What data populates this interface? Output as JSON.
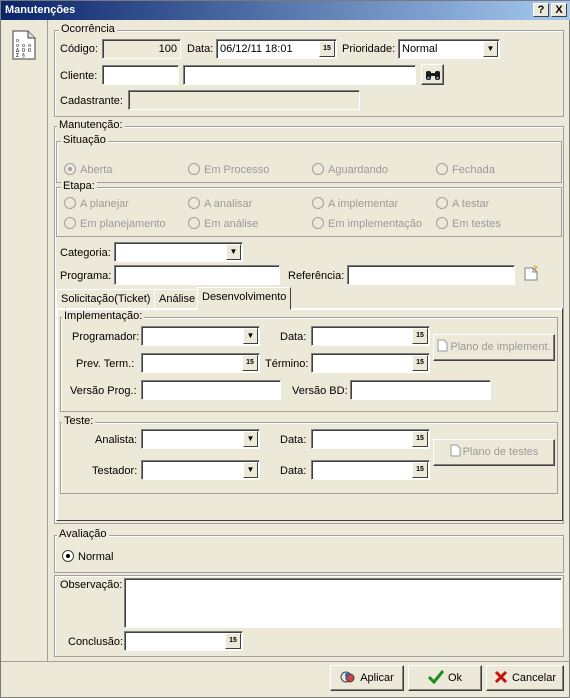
{
  "window": {
    "title": "Manutenções",
    "help": "?",
    "close": "X"
  },
  "ocorrencia": {
    "legend": "Ocorrência",
    "codigo_label": "Código:",
    "codigo_value": "100",
    "data_label": "Data:",
    "data_value": "06/12/11 18:01",
    "prioridade_label": "Prioridade:",
    "prioridade_value": "Normal",
    "cliente_label": "Cliente:",
    "cliente_code": "",
    "cliente_name": "",
    "cadastrante_label": "Cadastrante:",
    "cadastrante_value": ""
  },
  "manutencao": {
    "legend": "Manutenção:",
    "situacao": {
      "legend": "Situação",
      "options": [
        "Aberta",
        "Em Processo",
        "Aguardando",
        "Fechada"
      ],
      "selected": "Aberta"
    },
    "etapa": {
      "legend": "Etapa:",
      "options": [
        "A planejar",
        "A analisar",
        "A implementar",
        "A testar",
        "Em planejamento",
        "Em análise",
        "Em implementação",
        "Em testes"
      ]
    },
    "categoria_label": "Categoria:",
    "categoria_value": "",
    "programa_label": "Programa:",
    "programa_value": "",
    "referencia_label": "Referência:",
    "referencia_value": ""
  },
  "tabs": [
    "Solicitação(Ticket)",
    "Análise",
    "Desenvolvimento"
  ],
  "active_tab": "Desenvolvimento",
  "implementacao": {
    "legend": "Implementação:",
    "programador_label": "Programador:",
    "programador_value": "",
    "data_label": "Data:",
    "data_value": "",
    "prev_term_label": "Prev. Term.:",
    "prev_term_value": "",
    "termino_label": "Término:",
    "termino_value": "",
    "plano_button": "Plano de implement.",
    "versao_prog_label": "Versão Prog.:",
    "versao_prog_value": "",
    "versao_bd_label": "Versão BD:",
    "versao_bd_value": ""
  },
  "teste": {
    "legend": "Teste:",
    "analista_label": "Analista:",
    "analista_value": "",
    "data_label": "Data:",
    "data_value": "",
    "testador_label": "Testador:",
    "testador_value": "",
    "data2_label": "Data:",
    "data2_value": "",
    "plano_button": "Plano de testes"
  },
  "avaliacao": {
    "legend": "Avaliação",
    "option": "Normal"
  },
  "observacao_label": "Observação:",
  "observacao_value": "",
  "conclusao_label": "Conclusão:",
  "conclusao_value": "",
  "buttons": {
    "apply": "Aplicar",
    "ok": "Ok",
    "cancel": "Cancelar"
  },
  "calendar_icon_text": "15",
  "colors": {
    "titlebar_start": "#0a246a",
    "titlebar_end": "#a6caf0",
    "face": "#ece9d8",
    "ok_green": "#1a8c1a",
    "cancel_red": "#c81010"
  }
}
